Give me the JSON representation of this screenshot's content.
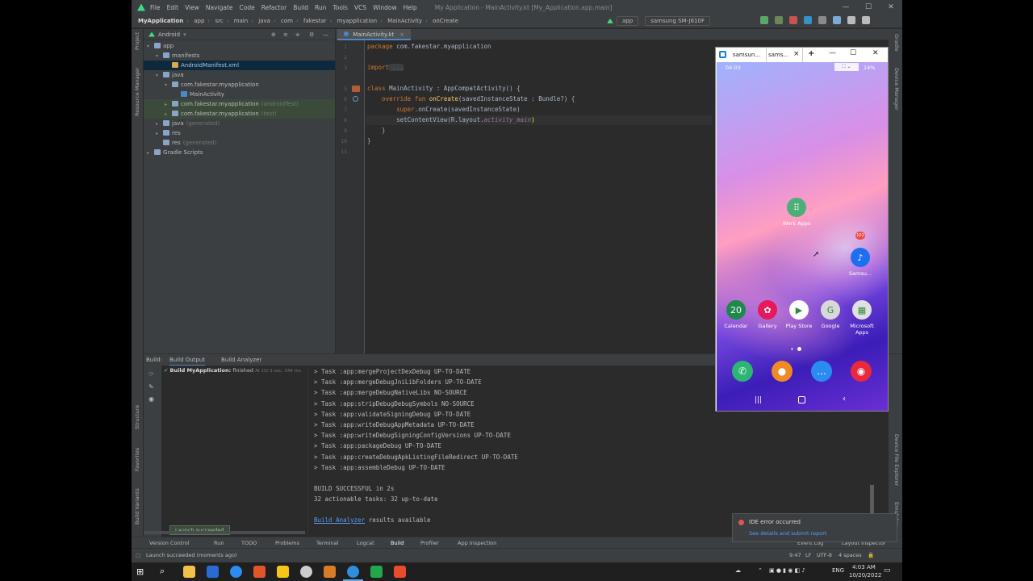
{
  "menubar": {
    "items": [
      "File",
      "Edit",
      "View",
      "Navigate",
      "Code",
      "Refactor",
      "Build",
      "Run",
      "Tools",
      "VCS",
      "Window",
      "Help"
    ],
    "title": "My Application - MainActivity.kt [My_Application.app.main]"
  },
  "navbar": {
    "crumbs": [
      "MyApplication",
      "app",
      "src",
      "main",
      "java",
      "com",
      "fakestar",
      "myapplication",
      "MainActivity",
      "onCreate"
    ],
    "run_config": "app",
    "device": "samsung SM-J610F"
  },
  "project": {
    "view": "Android",
    "tree": [
      {
        "label": "app",
        "extra": "",
        "level": 0,
        "arrow": "▾"
      },
      {
        "label": "manifests",
        "extra": "",
        "level": 1,
        "arrow": "▾"
      },
      {
        "label": "AndroidManifest.xml",
        "extra": "",
        "level": 2,
        "arrow": ""
      },
      {
        "label": "java",
        "extra": "",
        "level": 1,
        "arrow": "▾"
      },
      {
        "label": "com.fakestar.myapplication",
        "extra": "",
        "level": 2,
        "arrow": "▾"
      },
      {
        "label": "MainActivity",
        "extra": "",
        "level": 3,
        "arrow": ""
      },
      {
        "label": "com.fakestar.myapplication",
        "extra": "(androidTest)",
        "level": 2,
        "arrow": "▸"
      },
      {
        "label": "com.fakestar.myapplication",
        "extra": "(test)",
        "level": 2,
        "arrow": "▸"
      },
      {
        "label": "java",
        "extra": "(generated)",
        "level": 1,
        "arrow": "▸"
      },
      {
        "label": "res",
        "extra": "",
        "level": 1,
        "arrow": "▸"
      },
      {
        "label": "res",
        "extra": "(generated)",
        "level": 1,
        "arrow": ""
      },
      {
        "label": "Gradle Scripts",
        "extra": "",
        "level": 0,
        "arrow": "▸"
      }
    ]
  },
  "editor": {
    "tab": "MainActivity.kt",
    "line_numbers": [
      "1",
      "2",
      "3",
      "5",
      "6",
      "7",
      "8",
      "9",
      "10",
      "11"
    ],
    "lines": {
      "l1a": "package",
      "l1b": " com.fakestar.myapplication",
      "l3a": "import",
      "l3b": " ...",
      "l6a": "class",
      "l6b": " MainActivity : AppCompatActivity() {",
      "l7a": "    override fun ",
      "l7b": "onCreate",
      "l7c": "(savedInstanceState : Bundle?) {",
      "l8a": "        super",
      "l8b": ".onCreate(savedInstanceState)",
      "l9a": "        setContentView(R.layout.",
      "l9b": "activity_main",
      "l9c": ")",
      "l10": "    }",
      "l11": "}"
    }
  },
  "left_strip": [
    "Project",
    "Resource Manager"
  ],
  "build": {
    "tabs": [
      "Build:",
      "Build Output",
      "Build Analyzer"
    ],
    "tree_item": "Build MyApplication:",
    "tree_status": "finished",
    "tree_time": "At 10/ 2 sec, 344 ms",
    "output": [
      "> Task :app:mergeProjectDexDebug UP-TO-DATE",
      "> Task :app:mergeDebugJniLibFolders UP-TO-DATE",
      "> Task :app:mergeDebugNativeLibs NO-SOURCE",
      "> Task :app:stripDebugDebugSymbols NO-SOURCE",
      "> Task :app:validateSigningDebug UP-TO-DATE",
      "> Task :app:writeDebugAppMetadata UP-TO-DATE",
      "> Task :app:writeDebugSigningConfigVersions UP-TO-DATE",
      "> Task :app:packageDebug UP-TO-DATE",
      "> Task :app:createDebugApkListingFileRedirect UP-TO-DATE",
      "> Task :app:assembleDebug UP-TO-DATE"
    ],
    "success": "BUILD SUCCESSFUL in 2s",
    "tasks": "32 actionable tasks: 32 up-to-date",
    "analyzer_link": "Build Analyzer",
    "analyzer_rest": " results available",
    "tooltip": "Launch succeeded"
  },
  "tool_windows": [
    "Version Control",
    "Run",
    "TODO",
    "Problems",
    "Terminal",
    "Logcat",
    "Build",
    "Profiler",
    "App Inspection"
  ],
  "side_labels": [
    "Structure",
    "Favorites",
    "Build Variants"
  ],
  "right_labels": [
    "Gradle",
    "Device Manager",
    "Device File Explorer",
    "Emulator"
  ],
  "status": {
    "message": "Launch succeeded (moments ago)",
    "position": "9:47",
    "sep": "LF",
    "encoding": "UTF-8",
    "indent": "4 spaces",
    "event_log": "Event Log",
    "layout_inspector": "Layout Inspector"
  },
  "notification": {
    "title": "IDE error occurred",
    "link": "See details and submit report"
  },
  "mirror": {
    "tabs": [
      "samsun...",
      "sams..."
    ],
    "phone_time": "04:03",
    "battery": "14%",
    "apps": [
      {
        "label": "Work Apps",
        "color": "#4caf7a",
        "icon": "⠿"
      },
      {
        "label": "Samsu...",
        "color": "#1e6ff0",
        "icon": "♪"
      },
      {
        "label": "Calendar",
        "color": "#1b8a4a",
        "icon": "20"
      },
      {
        "label": "Gallery",
        "color": "#e5195b",
        "icon": "✿"
      },
      {
        "label": "Play Store",
        "color": "#ffffff",
        "icon": "▶"
      },
      {
        "label": "Google",
        "color": "#d8d8d8",
        "icon": "G"
      },
      {
        "label": "Microsoft Apps",
        "color": "#e0e0e0",
        "icon": "▦"
      }
    ],
    "badge": "102",
    "dock": [
      {
        "name": "phone",
        "color": "#2bb673",
        "icon": "✆"
      },
      {
        "name": "contacts",
        "color": "#f08a24",
        "icon": "●"
      },
      {
        "name": "messages",
        "color": "#2a8cf0",
        "icon": "…"
      },
      {
        "name": "camera",
        "color": "#e8283c",
        "icon": "◉"
      }
    ]
  },
  "taskbar": {
    "lang": "ENG",
    "time": "4:03 AM",
    "date": "10/20/2022"
  }
}
